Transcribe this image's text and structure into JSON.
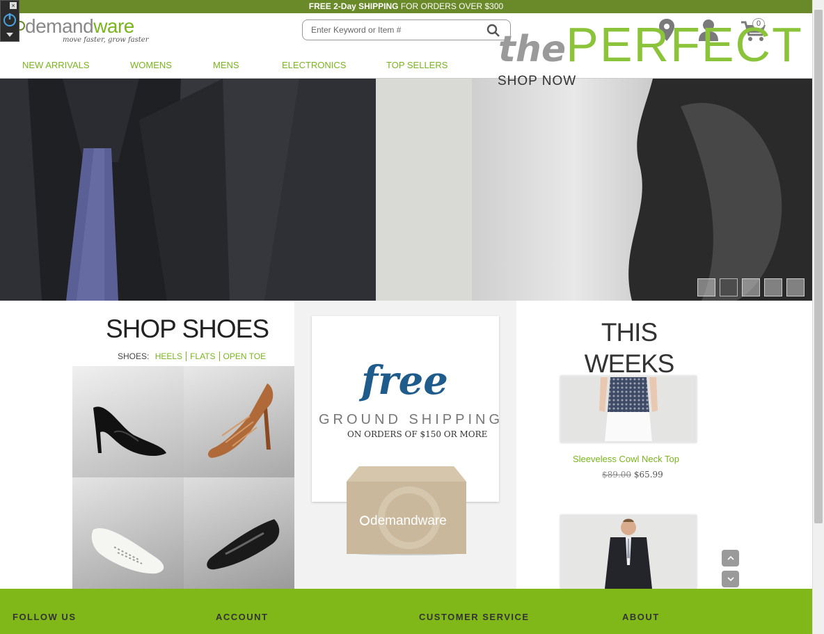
{
  "promo": {
    "bold": "FREE 2-Day SHIPPING",
    "rest": " FOR ORDERS OVER $300"
  },
  "widget": {
    "close": "×"
  },
  "logo": {
    "name_a": "demand",
    "name_b": "ware",
    "tagline": "move faster, grow faster"
  },
  "search": {
    "placeholder": "Enter Keyword or Item #"
  },
  "cart": {
    "count": "0"
  },
  "nav": [
    "NEW ARRIVALS",
    "WOMENS",
    "MENS",
    "ELECTRONICS",
    "TOP SELLERS"
  ],
  "hero": {
    "the": "the",
    "perfect": "PERFECT",
    "cta": "SHOP NOW"
  },
  "shoes": {
    "title": "SHOP SHOES",
    "prefix": "SHOES:",
    "links": [
      "HEELS",
      "FLATS",
      "OPEN TOE"
    ]
  },
  "shipping": {
    "free": "free",
    "ground": "GROUND SHIPPING",
    "orders": "ON ORDERS OF $150 OR MORE",
    "box_brand": "demandware"
  },
  "deals": {
    "title": "THIS WEEKS DEALS",
    "items": [
      {
        "name": "Sleeveless Cowl Neck Top",
        "old_price": "$89.00",
        "new_price": "$65.99"
      }
    ],
    "up": "⌃",
    "down": "⌄"
  },
  "footer": [
    "FOLLOW US",
    "ACCOUNT",
    "CUSTOMER SERVICE",
    "ABOUT"
  ],
  "colors": {
    "brand_green": "#79b51c",
    "footer_green": "#80b819",
    "promo_green": "#6a8a2a",
    "free_blue": "#1f5c8c"
  }
}
